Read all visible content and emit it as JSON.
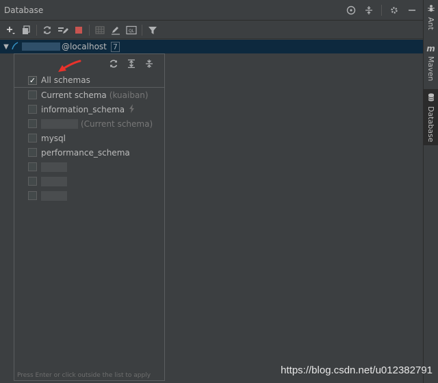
{
  "window": {
    "title": "Database"
  },
  "header_icons": [
    "target-icon",
    "collapse-icon",
    "gear-icon",
    "minimize-icon"
  ],
  "toolbar": {
    "icons": [
      "add-icon",
      "duplicate-icon",
      "refresh-icon",
      "edit-icon",
      "stop-icon",
      "table-icon",
      "pencil-icon",
      "console-icon",
      "filter-icon"
    ]
  },
  "tree": {
    "host": "@localhost",
    "count": "7"
  },
  "schema_popup": {
    "tool_icons": [
      "refresh-icon",
      "expand-all-icon",
      "collapse-all-icon"
    ],
    "items": [
      {
        "label": "All schemas",
        "hint": "",
        "checked": true
      },
      {
        "label": "Current schema",
        "hint": "(kuaiban)",
        "checked": false
      },
      {
        "label": "information_schema",
        "hint": "",
        "checked": false
      },
      {
        "label": "",
        "hint": "(Current schema)",
        "checked": false
      },
      {
        "label": "mysql",
        "hint": "",
        "checked": false
      },
      {
        "label": "performance_schema",
        "hint": "",
        "checked": false
      },
      {
        "label": "",
        "hint": "",
        "checked": false
      },
      {
        "label": "",
        "hint": "",
        "checked": false
      },
      {
        "label": "",
        "hint": "",
        "checked": false
      }
    ],
    "footer": "Press Enter or click outside the list to apply"
  },
  "side_tabs": [
    {
      "label": "Ant",
      "icon": "ant-icon"
    },
    {
      "label": "Maven",
      "icon": "maven-icon"
    },
    {
      "label": "Database",
      "icon": "database-icon"
    }
  ],
  "watermark": "https://blog.csdn.net/u012382791",
  "colors": {
    "selection": "#0d293e",
    "accent": "#3592c4",
    "arrow": "#e8322b"
  }
}
